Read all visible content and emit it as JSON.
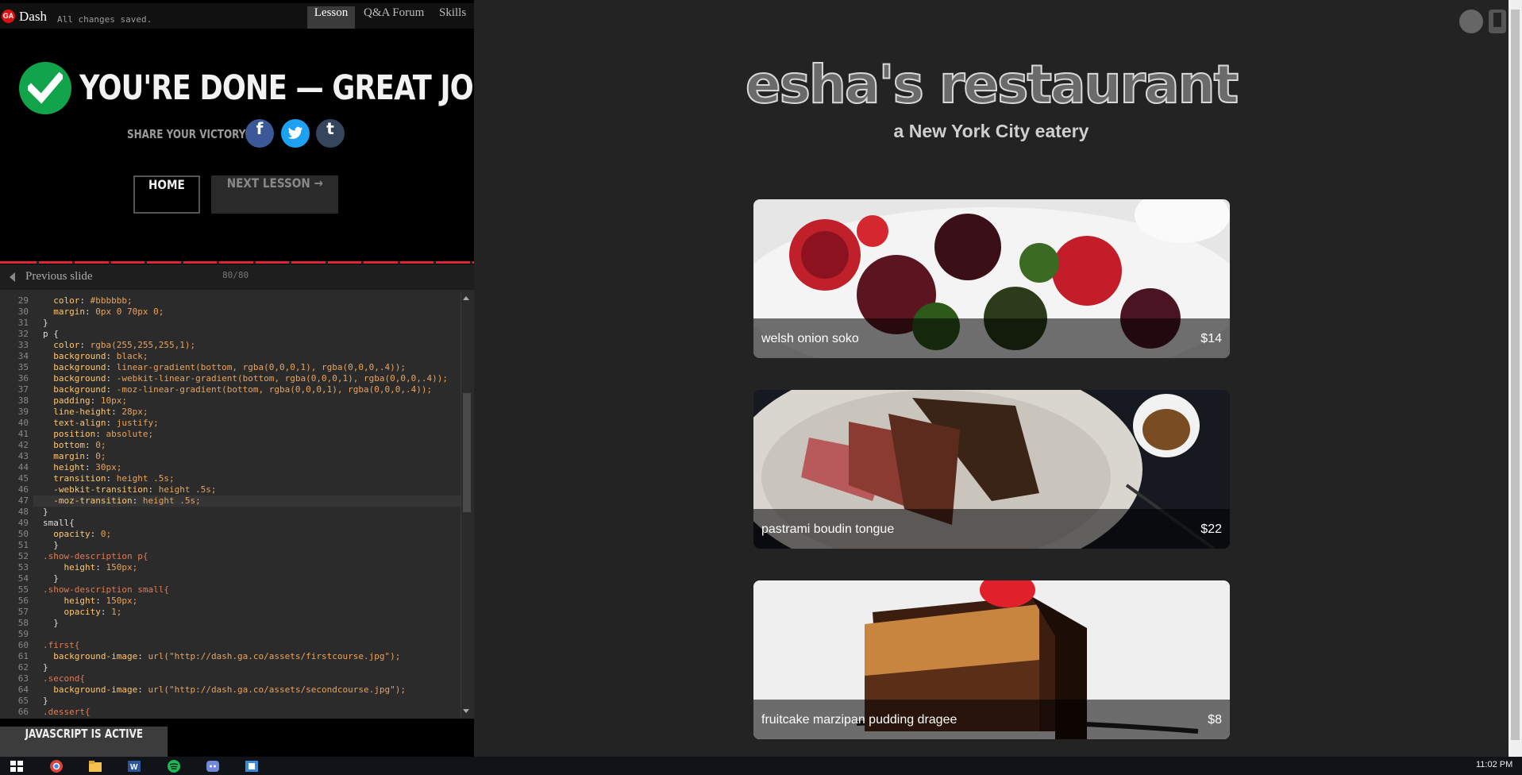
{
  "topbar": {
    "brand": "Dash",
    "logo_text": "GA",
    "save_status": "All changes saved.",
    "tabs": [
      {
        "label": "Lesson",
        "active": true
      },
      {
        "label": "Q&A Forum",
        "active": false
      },
      {
        "label": "Skills",
        "active": false
      }
    ]
  },
  "completion": {
    "title": "YOU'RE DONE — GREAT JOB!",
    "share_label": "SHARE YOUR VICTORY:",
    "social": {
      "facebook": "f",
      "twitter": "t",
      "tumblr": "t"
    },
    "home_label": "HOME",
    "next_label": "NEXT LESSON →"
  },
  "slides": {
    "prev_label": "Previous slide",
    "counter": "80/80"
  },
  "editor": {
    "lines": [
      {
        "n": "29",
        "text": "  color: #bbbbbb;"
      },
      {
        "n": "30",
        "text": "  margin: 0px 0 70px 0;"
      },
      {
        "n": "31",
        "text": "}"
      },
      {
        "n": "32",
        "text": "p {"
      },
      {
        "n": "33",
        "text": "  color: rgba(255,255,255,1);"
      },
      {
        "n": "34",
        "text": "  background: black;"
      },
      {
        "n": "35",
        "text": "  background: linear-gradient(bottom, rgba(0,0,0,1), rgba(0,0,0,.4));"
      },
      {
        "n": "36",
        "text": "  background: -webkit-linear-gradient(bottom, rgba(0,0,0,1), rgba(0,0,0,.4));"
      },
      {
        "n": "37",
        "text": "  background: -moz-linear-gradient(bottom, rgba(0,0,0,1), rgba(0,0,0,.4));"
      },
      {
        "n": "38",
        "text": "  padding: 10px;"
      },
      {
        "n": "39",
        "text": "  line-height: 28px;"
      },
      {
        "n": "40",
        "text": "  text-align: justify;"
      },
      {
        "n": "41",
        "text": "  position: absolute;"
      },
      {
        "n": "42",
        "text": "  bottom: 0;"
      },
      {
        "n": "43",
        "text": "  margin: 0;"
      },
      {
        "n": "44",
        "text": "  height: 30px;"
      },
      {
        "n": "45",
        "text": "  transition: height .5s;"
      },
      {
        "n": "46",
        "text": "  -webkit-transition: height .5s;"
      },
      {
        "n": "47",
        "text": "  -moz-transition: height .5s;"
      },
      {
        "n": "48",
        "text": "}"
      },
      {
        "n": "49",
        "text": "small{"
      },
      {
        "n": "50",
        "text": "  opacity: 0;"
      },
      {
        "n": "51",
        "text": "  }"
      },
      {
        "n": "52",
        "text": ".show-description p{"
      },
      {
        "n": "53",
        "text": "    height: 150px;"
      },
      {
        "n": "54",
        "text": "  }"
      },
      {
        "n": "55",
        "text": ".show-description small{"
      },
      {
        "n": "56",
        "text": "    height: 150px;"
      },
      {
        "n": "57",
        "text": "    opacity: 1;"
      },
      {
        "n": "58",
        "text": "  }"
      },
      {
        "n": "59",
        "text": ""
      },
      {
        "n": "60",
        "text": ".first{"
      },
      {
        "n": "61",
        "text": "  background-image: url(\"http://dash.ga.co/assets/firstcourse.jpg\");"
      },
      {
        "n": "62",
        "text": "}"
      },
      {
        "n": "63",
        "text": ".second{"
      },
      {
        "n": "64",
        "text": "  background-image: url(\"http://dash.ga.co/assets/secondcourse.jpg\");"
      },
      {
        "n": "65",
        "text": "}"
      },
      {
        "n": "66",
        "text": ".dessert{"
      }
    ]
  },
  "js_status": "JAVASCRIPT IS ACTIVE",
  "preview": {
    "title": "esha's restaurant",
    "subtitle": "a New York City eatery",
    "dishes": [
      {
        "name": "welsh onion soko",
        "price": "$14"
      },
      {
        "name": "pastrami boudin tongue",
        "price": "$22"
      },
      {
        "name": "fruitcake marzipan pudding dragee",
        "price": "$8"
      }
    ]
  },
  "taskbar": {
    "clock": "11:02 PM",
    "apps": [
      "windows-start",
      "chrome",
      "file-explorer",
      "word",
      "spotify",
      "discord",
      "app"
    ]
  },
  "colors": {
    "accent_red": "#e02433",
    "check_green": "#12a44b",
    "facebook": "#3b5998",
    "twitter": "#1da1f2",
    "tumblr": "#35465c"
  }
}
